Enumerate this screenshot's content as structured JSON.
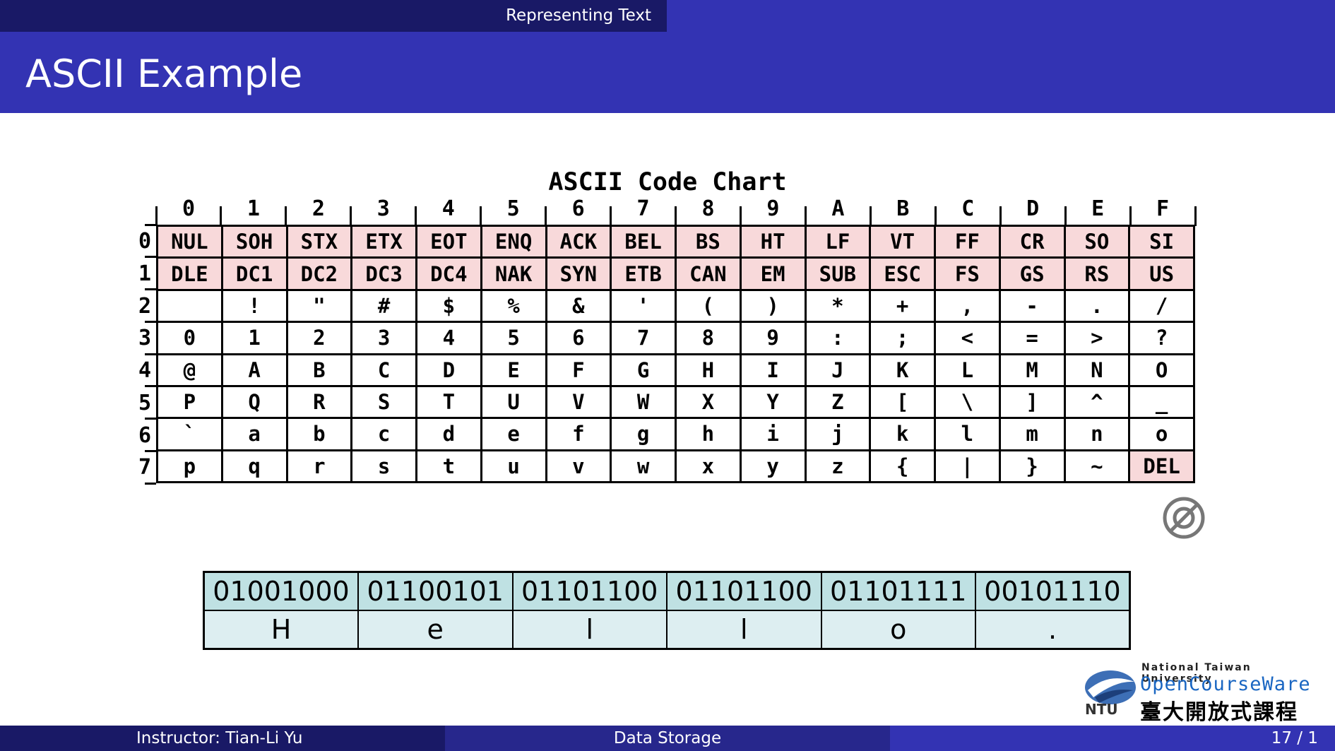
{
  "header": {
    "section": "Representing Text",
    "title": "ASCII Example"
  },
  "ascii_chart": {
    "title": "ASCII Code Chart",
    "col_labels": [
      "0",
      "1",
      "2",
      "3",
      "4",
      "5",
      "6",
      "7",
      "8",
      "9",
      "A",
      "B",
      "C",
      "D",
      "E",
      "F"
    ],
    "row_labels": [
      "0",
      "1",
      "2",
      "3",
      "4",
      "5",
      "6",
      "7"
    ],
    "rows": [
      [
        "NUL",
        "SOH",
        "STX",
        "ETX",
        "EOT",
        "ENQ",
        "ACK",
        "BEL",
        "BS",
        "HT",
        "LF",
        "VT",
        "FF",
        "CR",
        "SO",
        "SI"
      ],
      [
        "DLE",
        "DC1",
        "DC2",
        "DC3",
        "DC4",
        "NAK",
        "SYN",
        "ETB",
        "CAN",
        "EM",
        "SUB",
        "ESC",
        "FS",
        "GS",
        "RS",
        "US"
      ],
      [
        " ",
        "!",
        "\"",
        "#",
        "$",
        "%",
        "&",
        "'",
        "(",
        ")",
        "*",
        "+",
        ",",
        "-",
        ".",
        "/"
      ],
      [
        "0",
        "1",
        "2",
        "3",
        "4",
        "5",
        "6",
        "7",
        "8",
        "9",
        ":",
        ";",
        "<",
        "=",
        ">",
        "?"
      ],
      [
        "@",
        "A",
        "B",
        "C",
        "D",
        "E",
        "F",
        "G",
        "H",
        "I",
        "J",
        "K",
        "L",
        "M",
        "N",
        "O"
      ],
      [
        "P",
        "Q",
        "R",
        "S",
        "T",
        "U",
        "V",
        "W",
        "X",
        "Y",
        "Z",
        "[",
        "\\",
        "]",
        "^",
        "_"
      ],
      [
        "`",
        "a",
        "b",
        "c",
        "d",
        "e",
        "f",
        "g",
        "h",
        "i",
        "j",
        "k",
        "l",
        "m",
        "n",
        "o"
      ],
      [
        "p",
        "q",
        "r",
        "s",
        "t",
        "u",
        "v",
        "w",
        "x",
        "y",
        "z",
        "{",
        "|",
        "}",
        "~",
        "DEL"
      ]
    ],
    "control_color": "#f8d9da"
  },
  "encoding_example": {
    "bits": [
      "01001000",
      "01100101",
      "01101100",
      "01101100",
      "01101111",
      "00101110"
    ],
    "chars": [
      "H",
      "e",
      "l",
      "l",
      "o",
      "."
    ],
    "bits_color": "#bfe1e3",
    "chars_color": "#ddeef1"
  },
  "logo": {
    "university": "National Taiwan University",
    "name": "OpenCourseWare",
    "chinese": "臺大開放式課程",
    "mark": "NTU"
  },
  "footer": {
    "instructor": "Instructor: Tian-Li Yu",
    "topic": "Data Storage",
    "page": "17 / 1"
  },
  "theme": {
    "dark": "#191966",
    "mid": "#27278c",
    "primary": "#3333b3"
  }
}
